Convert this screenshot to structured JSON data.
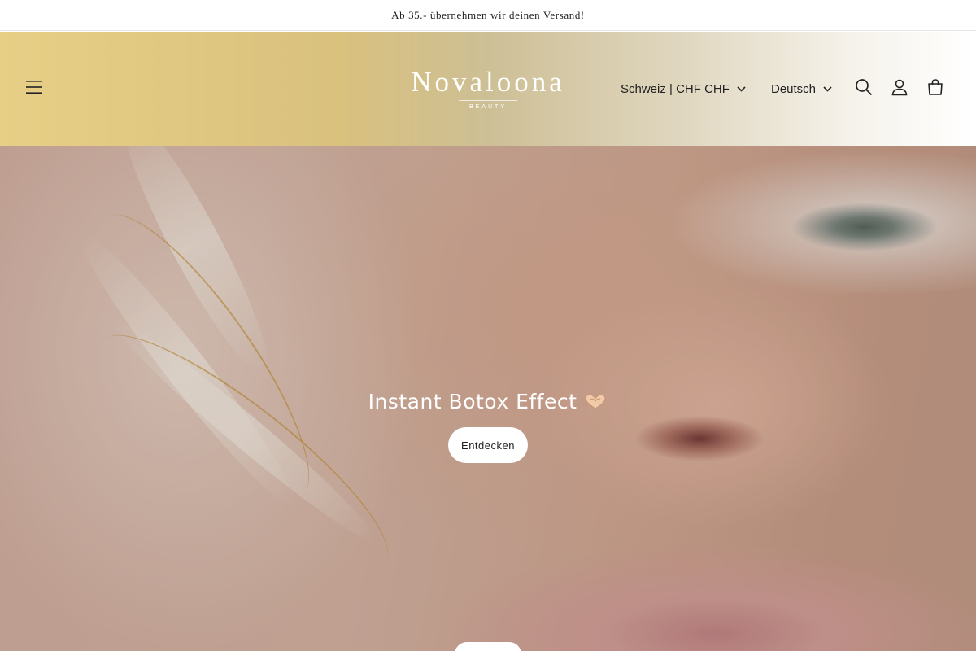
{
  "announcement": {
    "text": "Ab 35.- übernehmen wir deinen Versand!"
  },
  "header": {
    "logo": {
      "name": "Novaloona",
      "sub": "BEAUTY"
    },
    "country_selector": {
      "label": "Schweiz | CHF CHF"
    },
    "language_selector": {
      "label": "Deutsch"
    },
    "icons": [
      "menu-icon",
      "search-icon",
      "account-icon",
      "cart-icon"
    ]
  },
  "hero": {
    "title": "Instant Botox Effect",
    "emoji": "heart-hands",
    "cta_label": "Entdecken"
  },
  "colors": {
    "header_gradient_start": "#e7cf86",
    "header_gradient_end": "#ffffff",
    "text": "#222222",
    "hero_text": "#ffffff"
  }
}
